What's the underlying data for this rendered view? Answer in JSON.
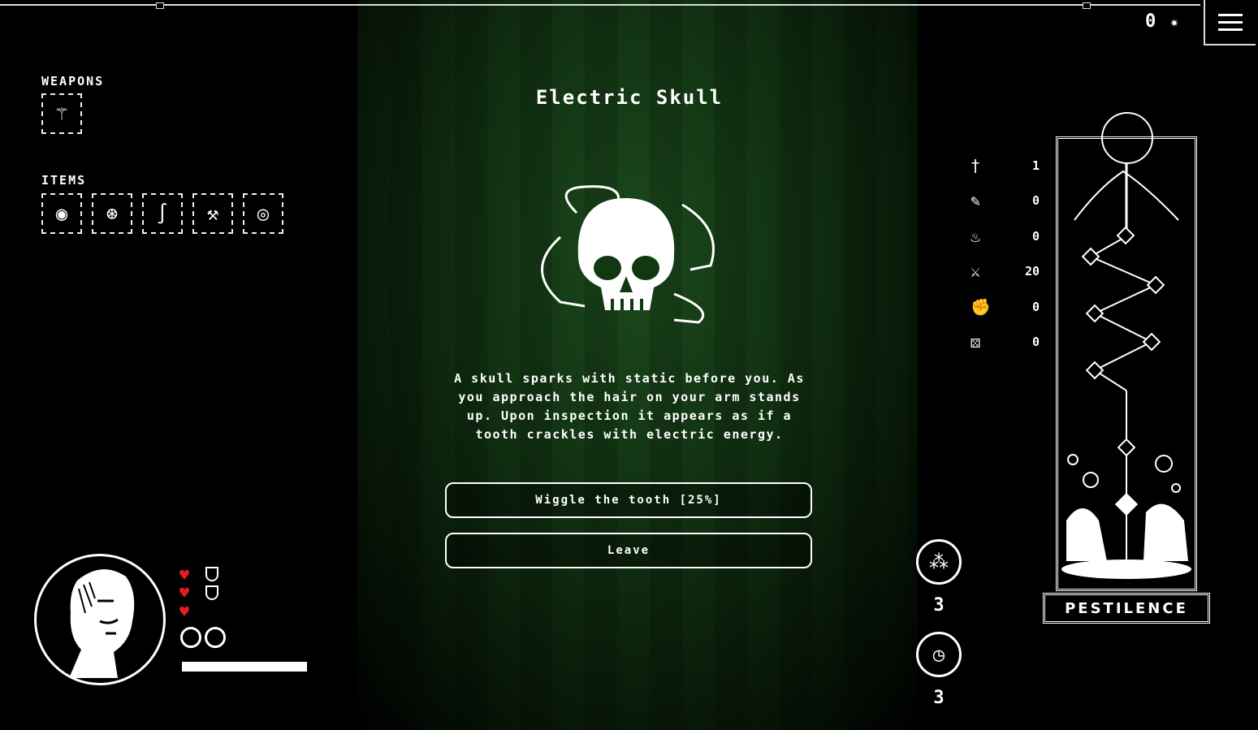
{
  "hud": {
    "currency_value": "0",
    "currency_icon": "sparkle-icon",
    "menu_icon": "hamburger-icon"
  },
  "inventory": {
    "weapons_label": "WEAPONS",
    "weapons": [
      {
        "icon": "trident-icon"
      }
    ],
    "items_label": "ITEMS",
    "items": [
      {
        "icon": "eye-amulet-icon"
      },
      {
        "icon": "orb-icon"
      },
      {
        "icon": "serpent-icon"
      },
      {
        "icon": "axe-icon"
      },
      {
        "icon": "ring-icon"
      }
    ]
  },
  "event": {
    "title": "Electric Skull",
    "image_icon": "skull-icon",
    "description": "A skull sparks with static before you. As you approach the hair on your arm stands up. Upon inspection it appears as if a tooth crackles with electric energy.",
    "choices": [
      {
        "label": "Wiggle the tooth [25%]"
      },
      {
        "label": "Leave"
      }
    ]
  },
  "stats": [
    {
      "icon": "dagger-icon",
      "value": "1"
    },
    {
      "icon": "feather-icon",
      "value": "0"
    },
    {
      "icon": "flame-icon",
      "value": "0"
    },
    {
      "icon": "crossed-swords-icon",
      "value": "20"
    },
    {
      "icon": "fist-icon",
      "value": "0"
    },
    {
      "icon": "dice-icon",
      "value": "0"
    }
  ],
  "counters": [
    {
      "icon": "three-dots-icon",
      "value": "3"
    },
    {
      "icon": "clock-icon",
      "value": "3"
    }
  ],
  "card": {
    "name": "PESTILENCE"
  },
  "player": {
    "hearts": 3,
    "shields": 2,
    "orbs": 2
  },
  "colors": {
    "heart": "#e81c1c",
    "corridor": "#1c4a1c"
  }
}
